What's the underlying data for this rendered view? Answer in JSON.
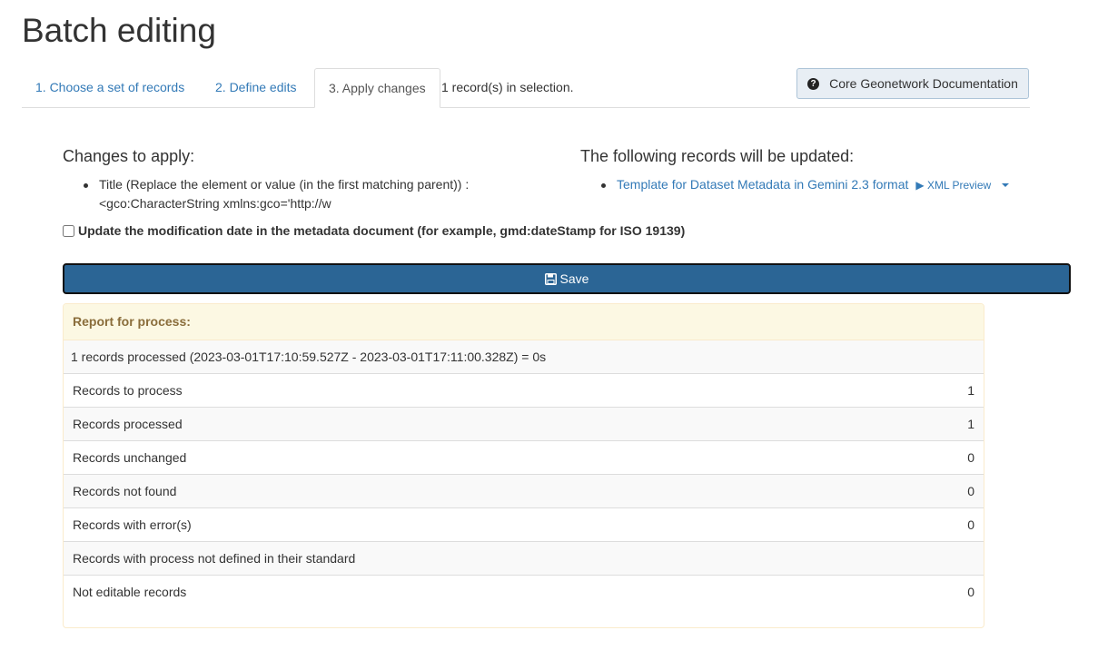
{
  "page": {
    "title": "Batch editing"
  },
  "tabs": [
    {
      "label": "1. Choose a set of records"
    },
    {
      "label": "2. Define edits"
    },
    {
      "label": "3. Apply changes",
      "active": true
    }
  ],
  "selection_count": "1 record(s) in selection.",
  "doc_button": {
    "label": "Core Geonetwork Documentation",
    "icon": "question-circle-icon"
  },
  "changes": {
    "heading": "Changes to apply:",
    "items": [
      {
        "text": "Title (Replace the element or value (in the first matching parent)) : <gco:CharacterString xmlns:gco='http://w"
      }
    ]
  },
  "records": {
    "heading": "The following records will be updated:",
    "items": [
      {
        "title": "Template for Dataset Metadata in Gemini 2.3 format",
        "preview_label": "▶ XML Preview"
      }
    ]
  },
  "update_modification_date": {
    "label": "Update the modification date in the metadata document (for example, gmd:dateStamp for ISO 19139)",
    "checked": false
  },
  "save_button": {
    "label": "Save",
    "icon": "floppy-disk-icon"
  },
  "report": {
    "heading": "Report for process:",
    "summary": "1 records processed (2023-03-01T17:10:59.527Z - 2023-03-01T17:11:00.328Z) = 0s",
    "rows": [
      {
        "label": "Records to process",
        "value": "1"
      },
      {
        "label": "Records processed",
        "value": "1"
      },
      {
        "label": "Records unchanged",
        "value": "0"
      },
      {
        "label": "Records not found",
        "value": "0"
      },
      {
        "label": "Records with error(s)",
        "value": "0"
      },
      {
        "label": "Records with process not defined in their standard",
        "value": ""
      },
      {
        "label": "Not editable records",
        "value": "0"
      }
    ]
  },
  "colors": {
    "link": "#337ab7",
    "save_button": "#2b6595",
    "report_heading_bg": "#fcf8e3",
    "report_heading_text": "#8a6d3b"
  }
}
